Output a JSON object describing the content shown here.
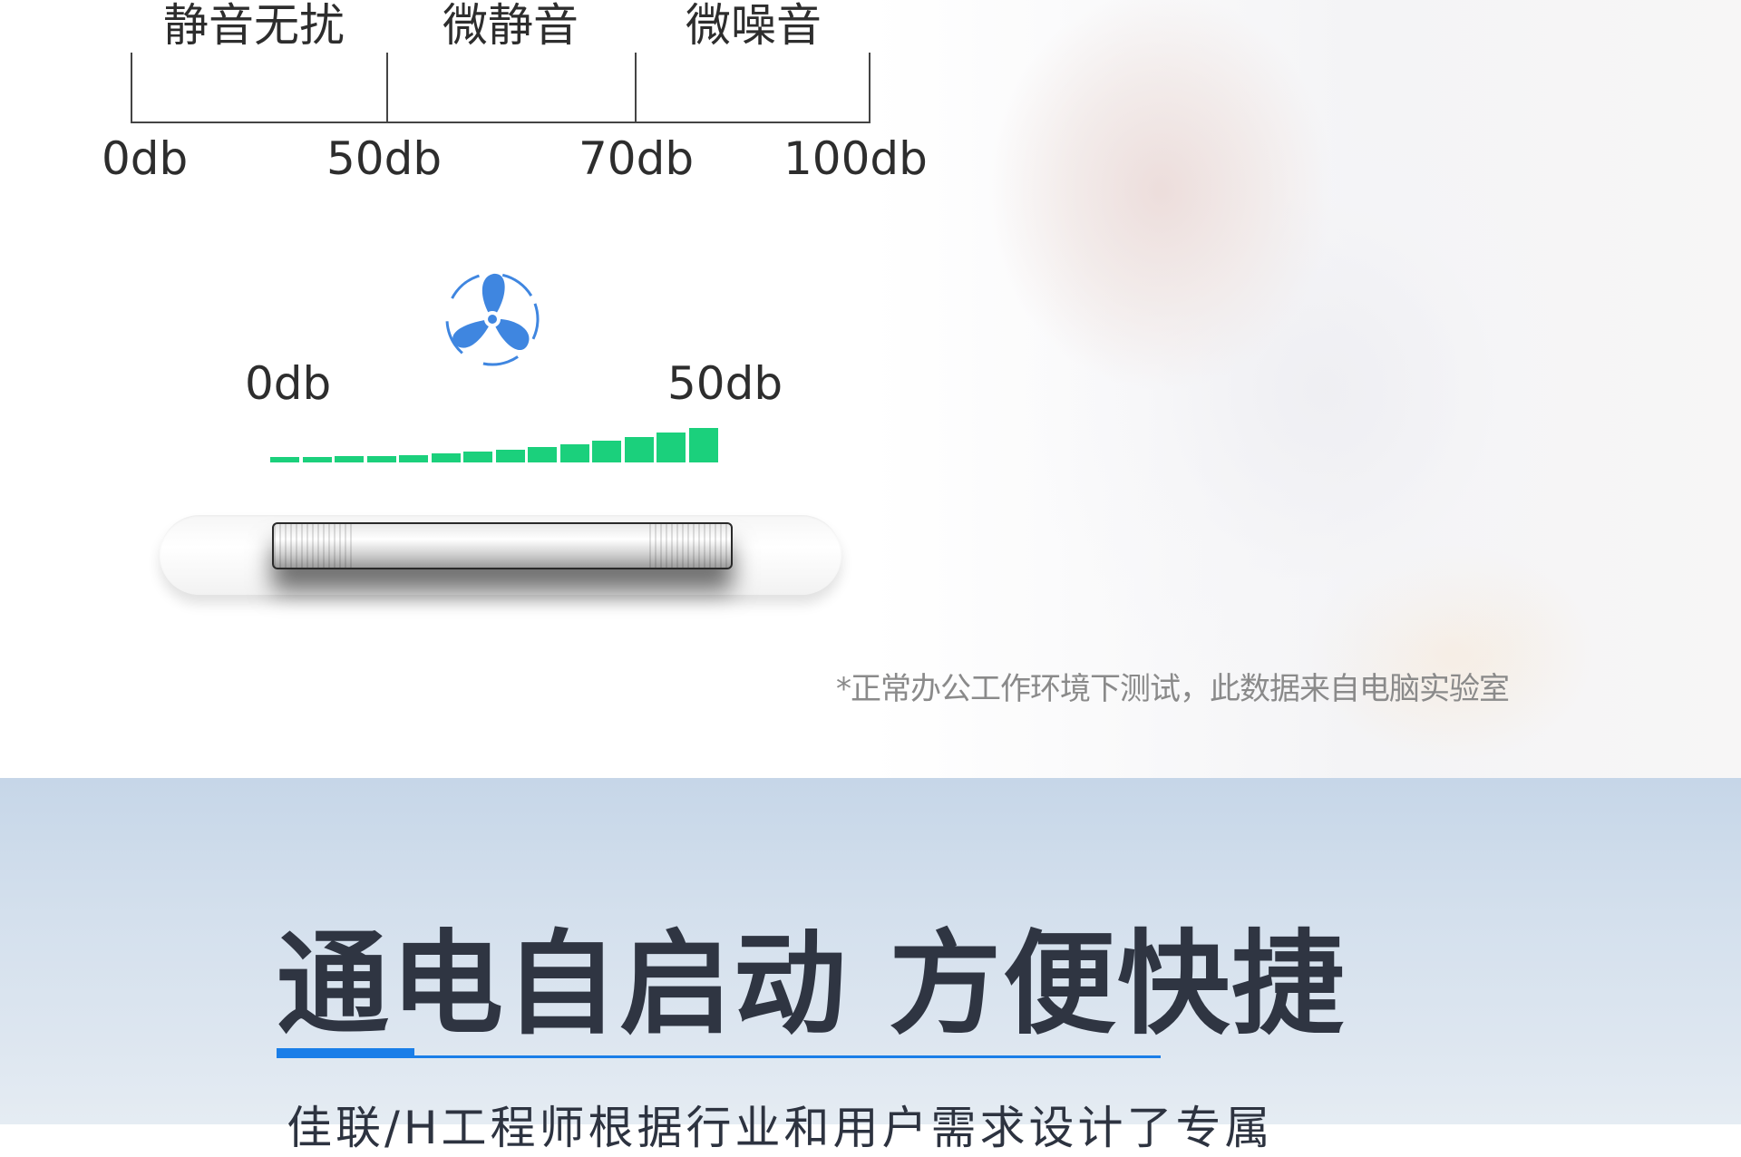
{
  "noise_scale": {
    "zone_labels": [
      "静音无扰",
      "微静音",
      "微噪音"
    ],
    "tick_labels": [
      "0db",
      "50db",
      "70db",
      "100db"
    ]
  },
  "fan_panel": {
    "icon": "fan-icon",
    "min_label": "0db",
    "max_label": "50db",
    "level_bars_count": 14,
    "bar_color": "#1bd07c"
  },
  "footnote": "*正常办公工作环境下测试，此数据来自电脑实验室",
  "section": {
    "headline": "通电自启动 方便快捷",
    "accent_color": "#1a7ee8",
    "body_text": "佳联/H工程师根据行业和用户需求设计了专属"
  }
}
